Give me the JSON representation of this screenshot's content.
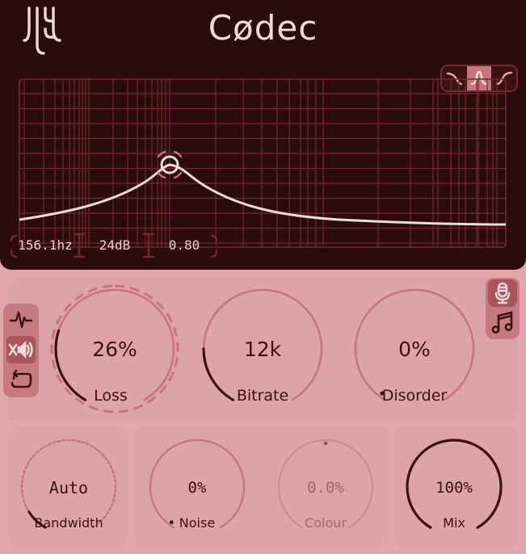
{
  "app": {
    "title": "Cødec"
  },
  "filter": {
    "types": [
      {
        "icon": "low-cut-icon",
        "active": false
      },
      {
        "icon": "peak-icon",
        "active": true
      },
      {
        "icon": "high-cut-icon",
        "active": false
      }
    ],
    "frequency": "156.1hz",
    "gain": "24dB",
    "q": "0.80"
  },
  "mode_buttons": [
    {
      "icon": "waveform-icon"
    },
    {
      "icon": "mute-speaker-icon"
    },
    {
      "icon": "loop-icon"
    }
  ],
  "source_buttons": [
    {
      "icon": "microphone-icon"
    },
    {
      "icon": "music-note-icon"
    }
  ],
  "knobs": {
    "loss": {
      "label": "Loss",
      "value": "26%"
    },
    "bitrate": {
      "label": "Bitrate",
      "value": "12k"
    },
    "disorder": {
      "label": "Disorder",
      "value": "0%"
    },
    "bandwidth": {
      "label": "Bandwidth",
      "value": "Auto"
    },
    "noise": {
      "label": "Noise",
      "value": "0%"
    },
    "colour": {
      "label": "Colour",
      "value": "0.0%"
    },
    "mix": {
      "label": "Mix",
      "value": "100%"
    }
  },
  "colors": {
    "header_bg": "#2b0b0c",
    "accent": "#c9737a",
    "panel": "#dca4a8",
    "text_dark": "#3a1214"
  }
}
